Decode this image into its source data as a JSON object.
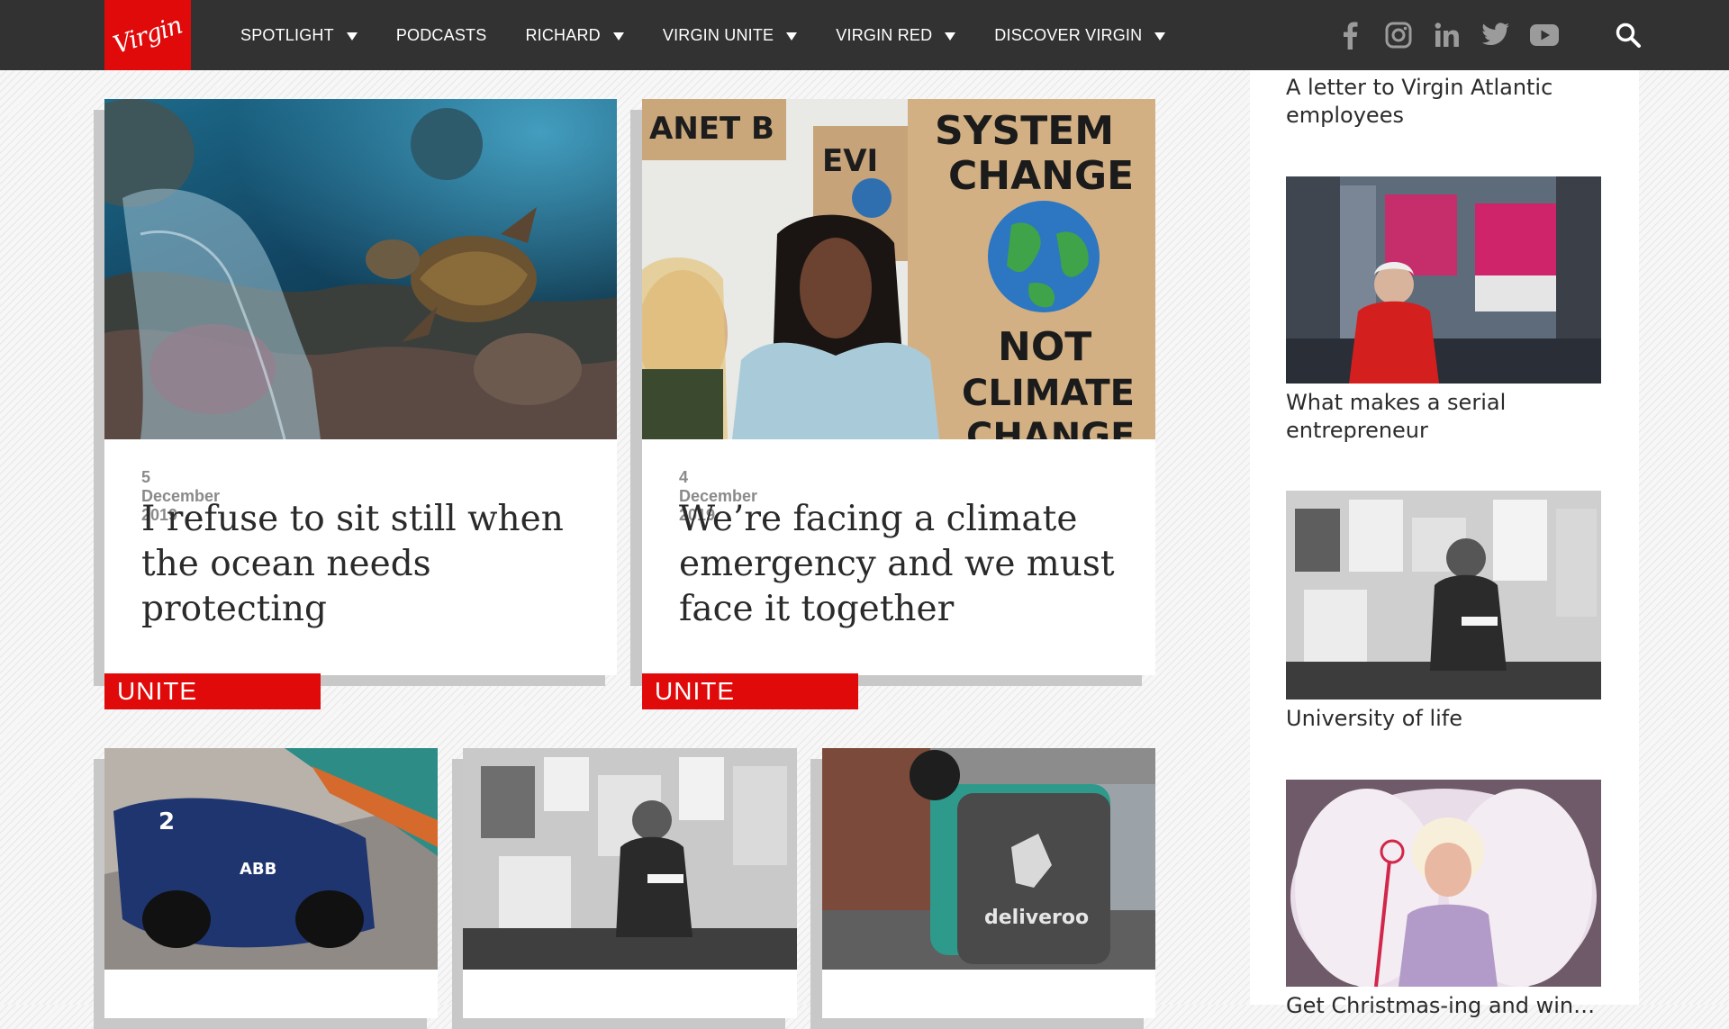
{
  "brand": {
    "logo_text": "Virgin",
    "accent": "#e10a0a",
    "nav_bg": "#323232"
  },
  "nav": {
    "items": [
      {
        "label": "SPOTLIGHT",
        "dropdown": true
      },
      {
        "label": "PODCASTS",
        "dropdown": false
      },
      {
        "label": "RICHARD",
        "dropdown": true
      },
      {
        "label": "VIRGIN UNITE",
        "dropdown": true
      },
      {
        "label": "VIRGIN RED",
        "dropdown": true
      },
      {
        "label": "DISCOVER VIRGIN",
        "dropdown": true
      }
    ],
    "socials": [
      "facebook-icon",
      "instagram-icon",
      "linkedin-icon",
      "twitter-icon",
      "youtube-icon"
    ],
    "search_icon": "search-icon"
  },
  "featured": [
    {
      "date": "5 December 2019",
      "title": "I refuse to sit still when the ocean needs protecting",
      "tag": "UNITE",
      "image": "sea turtle swimming near plastic bag on coral reef"
    },
    {
      "date": "4 December 2019",
      "title": "We’re facing a climate emergency and we must face it together",
      "tag": "UNITE",
      "image": "climate protesters holding signs"
    }
  ],
  "secondary": [
    {
      "image": "formula e race car"
    },
    {
      "image": "black and white photo of young man reading"
    },
    {
      "image": "deliveroo courier on bicycle"
    }
  ],
  "sidebar": {
    "items": [
      {
        "title": "A letter to Virgin Atlantic employees",
        "image": ""
      },
      {
        "title": "What makes a serial entrepreneur",
        "image": "man in red jacket in times square"
      },
      {
        "title": "University of life",
        "image": "black and white photo of young man reading"
      },
      {
        "title": "Get Christmas-ing and win…",
        "image": "drag queen in feather costume"
      }
    ]
  }
}
